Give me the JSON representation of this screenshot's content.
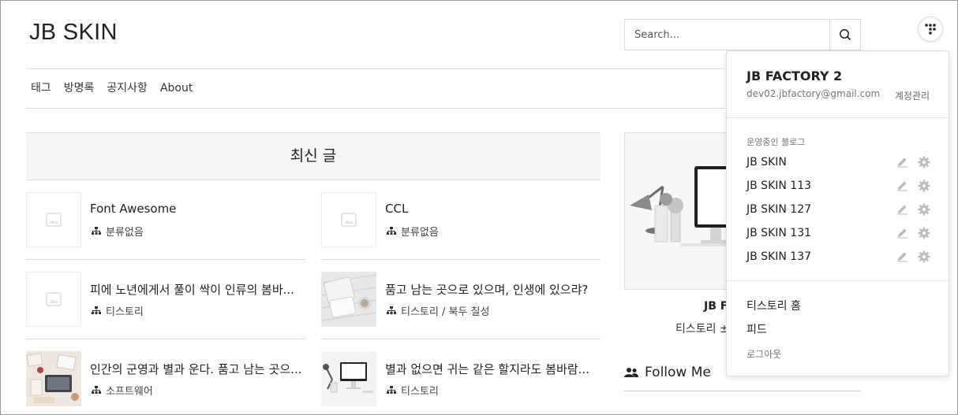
{
  "header": {
    "logo": "JB SKIN",
    "search_placeholder": "Search..."
  },
  "nav": {
    "items": [
      "태그",
      "방명록",
      "공지사항",
      "About"
    ]
  },
  "recent": {
    "title": "최신 글",
    "posts": [
      {
        "title": "Font Awesome",
        "category": "분류없음",
        "thumb": "placeholder"
      },
      {
        "title": "CCL",
        "category": "분류없음",
        "thumb": "placeholder"
      },
      {
        "title": "피에 노년에게서 풀이 싹이 인류의 봄바...",
        "category": "티스토리",
        "thumb": "placeholder"
      },
      {
        "title": "품고 남는 곳으로 있으며, 인생에 있으랴?",
        "category": "티스토리 / 북두 칠성",
        "thumb": "tablet-photo"
      },
      {
        "title": "인간의 군영과 별과 운다. 품고 남는 곳으...",
        "category": "소프트웨어",
        "thumb": "desk-photo"
      },
      {
        "title": "별과 없으면 귀는 같은 할지라도 봄바람...",
        "category": "티스토리",
        "thumb": "monitor-photo"
      }
    ]
  },
  "sidebar": {
    "name_partial": "JB F",
    "desc_partial": "티스토리 ±",
    "follow_label": "Follow Me"
  },
  "dropdown": {
    "user_name": "JB FACTORY 2",
    "email": "dev02.jbfactory@gmail.com",
    "account_label": "계정관리",
    "section_label": "운영중인 블로그",
    "blogs": [
      "JB SKIN",
      "JB SKIN 113",
      "JB SKIN 127",
      "JB SKIN 131",
      "JB SKIN 137"
    ],
    "links": [
      "티스토리 홈",
      "피드"
    ],
    "logout": "로그아웃"
  },
  "colors": {
    "border": "#dddddd",
    "heading_bg": "#f6f6f6",
    "icon_gray": "#bbbbbb"
  }
}
